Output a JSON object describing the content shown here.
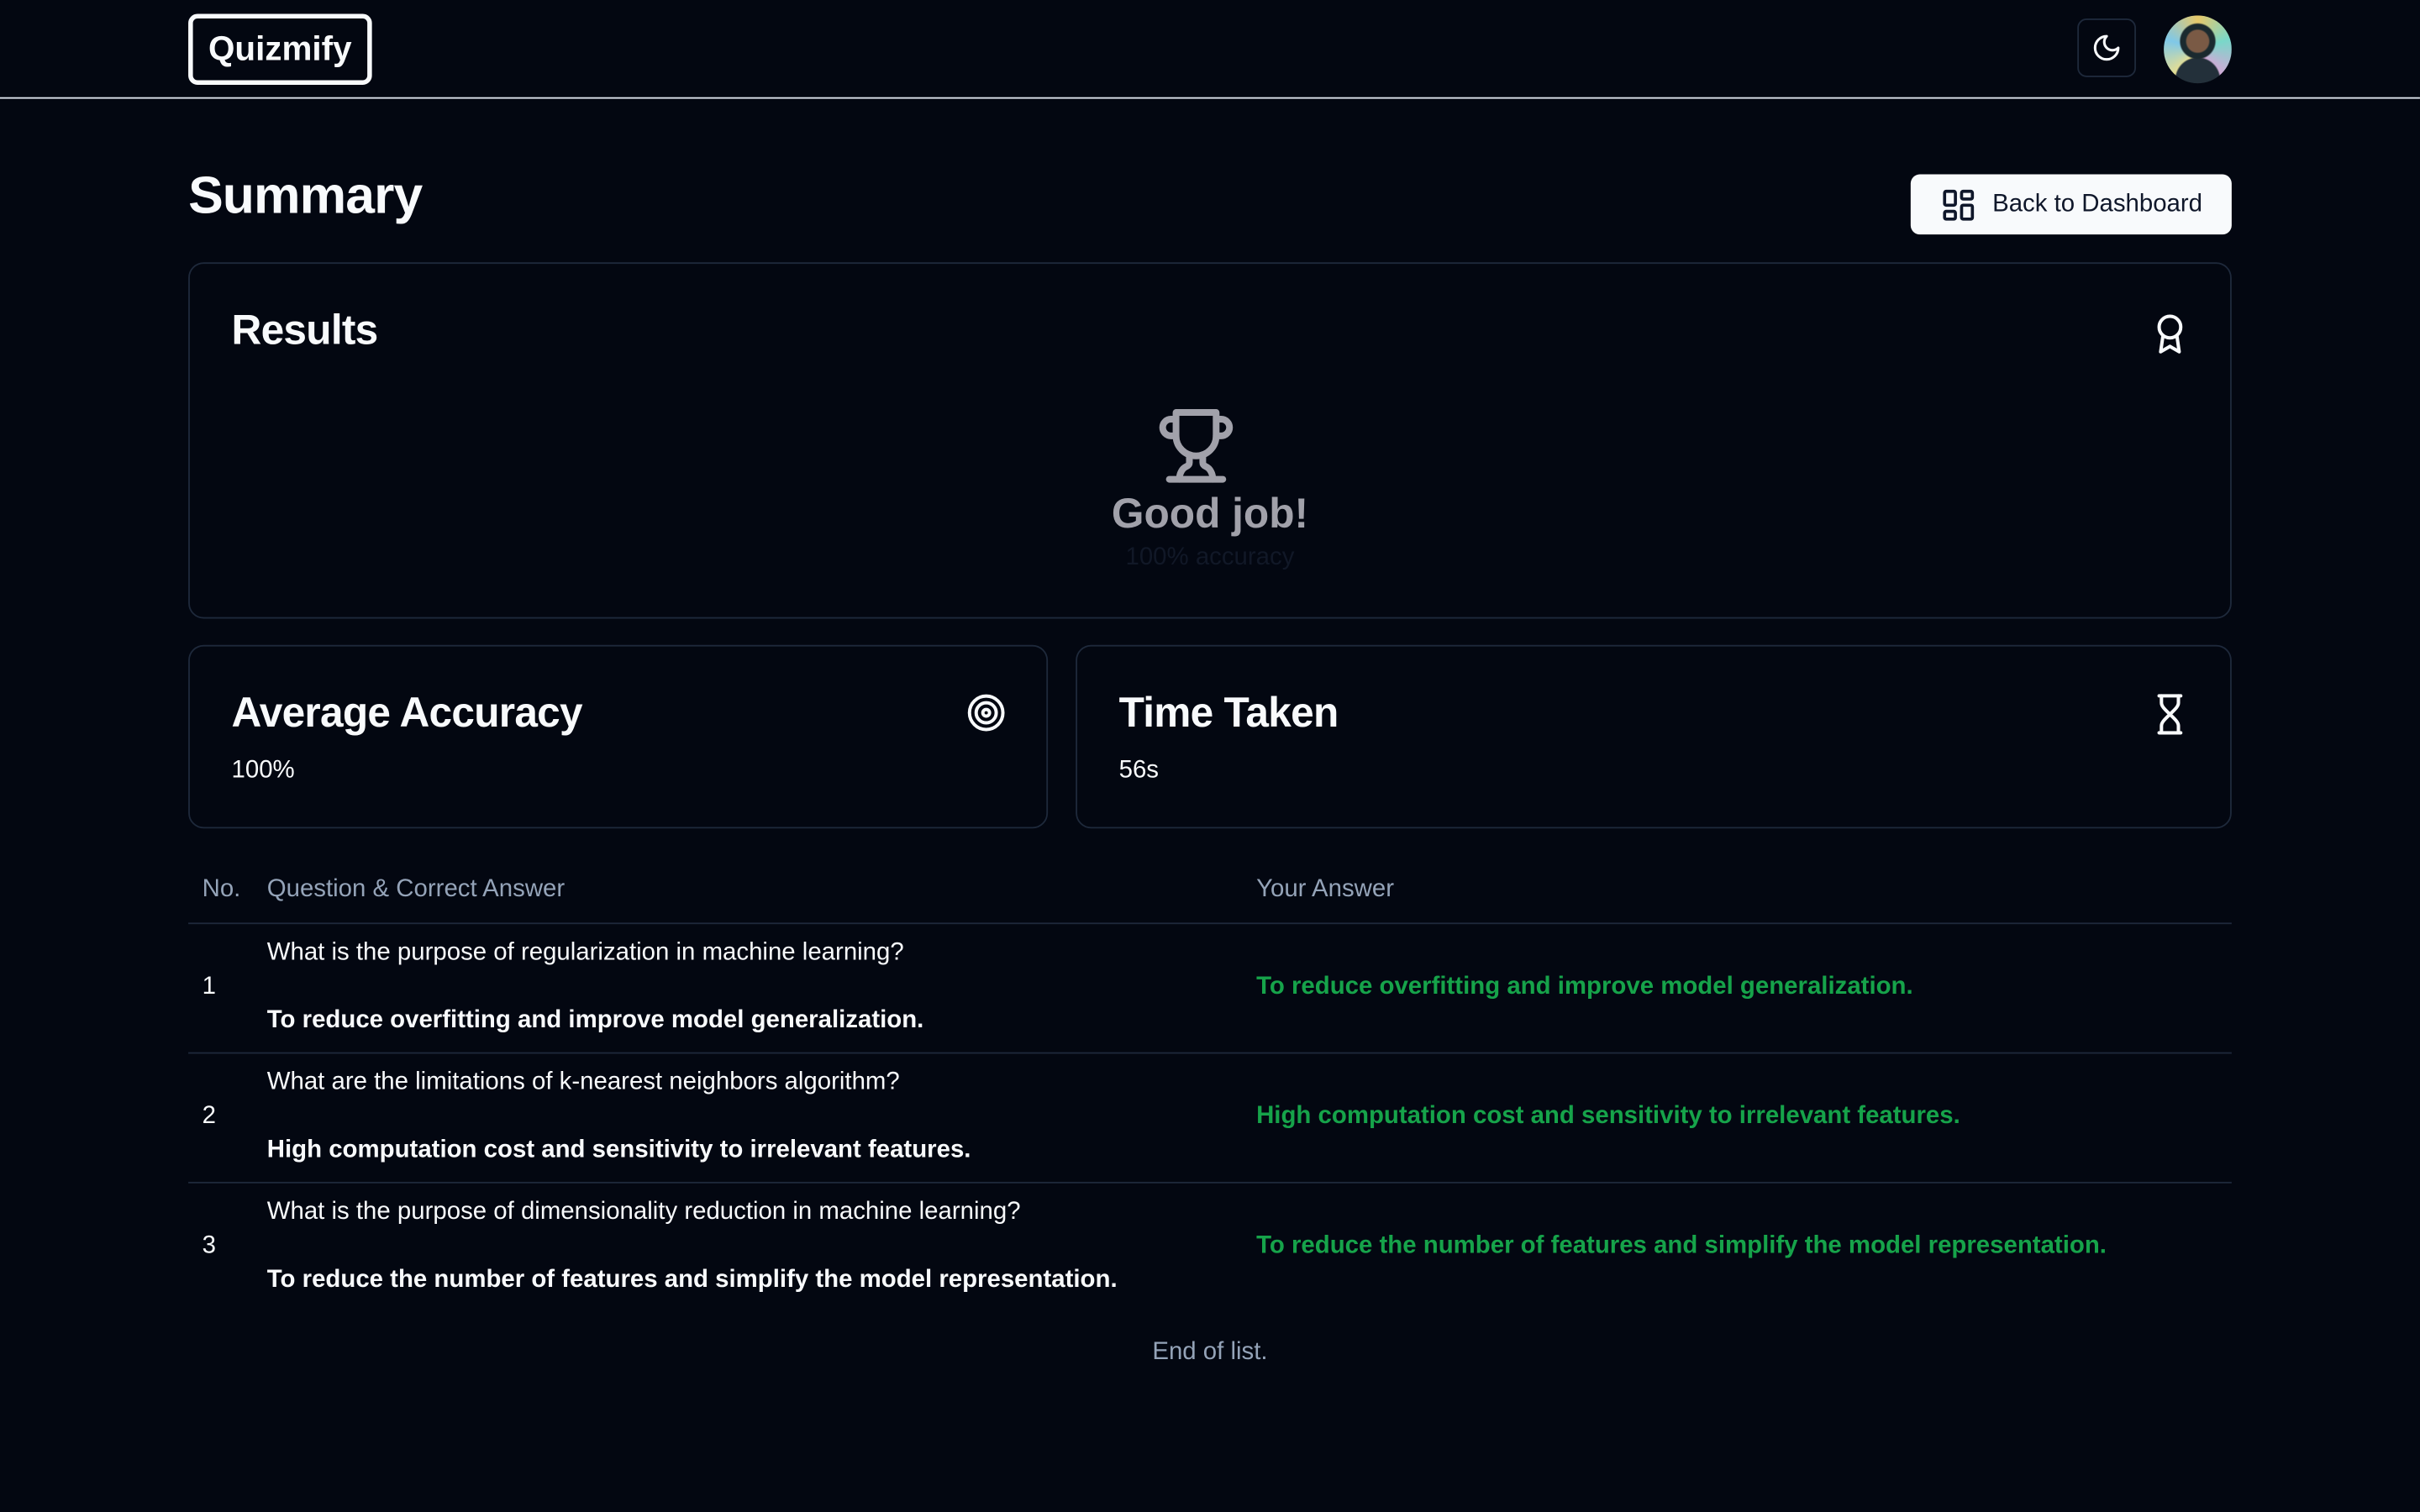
{
  "header": {
    "logo_text": "Quizmify",
    "theme_toggle_icon": "moon-icon",
    "avatar_alt": "user avatar"
  },
  "page": {
    "title": "Summary",
    "back_button_label": "Back to Dashboard",
    "back_button_icon": "layout-dashboard-icon"
  },
  "results": {
    "title": "Results",
    "icon": "award-icon",
    "center_icon": "trophy-icon",
    "message": "Good job!",
    "caption": "100% accuracy"
  },
  "accuracy_card": {
    "title": "Average Accuracy",
    "icon": "target-icon",
    "value": "100%"
  },
  "time_card": {
    "title": "Time Taken",
    "icon": "hourglass-icon",
    "value": "56s"
  },
  "table": {
    "headers": {
      "no": "No.",
      "question": "Question & Correct Answer",
      "your_answer": "Your Answer"
    },
    "rows": [
      {
        "no": "1",
        "question": "What is the purpose of regularization in machine learning?",
        "correct_answer": "To reduce overfitting and improve model generalization.",
        "your_answer": "To reduce overfitting and improve model generalization."
      },
      {
        "no": "2",
        "question": "What are the limitations of k-nearest neighbors algorithm?",
        "correct_answer": "High computation cost and sensitivity to irrelevant features.",
        "your_answer": "High computation cost and sensitivity to irrelevant features."
      },
      {
        "no": "3",
        "question": "What is the purpose of dimensionality reduction in machine learning?",
        "correct_answer": "To reduce the number of features and simplify the model representation.",
        "your_answer": "To reduce the number of features and simplify the model representation."
      }
    ],
    "end_text": "End of list."
  },
  "colors": {
    "background": "#030711",
    "correct": "#16a34a",
    "muted": "#94a3b8",
    "border": "#1e293b"
  }
}
